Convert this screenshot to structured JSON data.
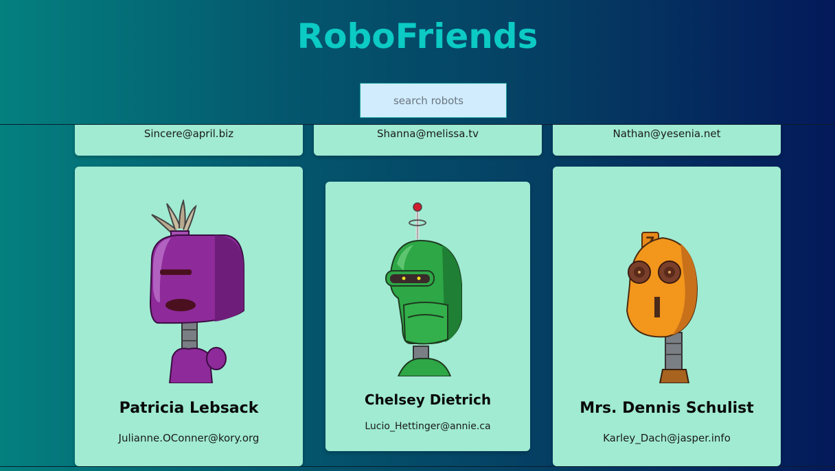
{
  "header": {
    "title": "RoboFriends"
  },
  "search": {
    "placeholder": "search robots"
  },
  "cards_partial": [
    {
      "email": "Sincere@april.biz"
    },
    {
      "email": "Shanna@melissa.tv"
    },
    {
      "email": "Nathan@yesenia.net"
    }
  ],
  "cards": [
    {
      "name": "Patricia Lebsack",
      "email": "Julianne.OConner@kory.org",
      "robot": "purple-robot"
    },
    {
      "name": "Chelsey Dietrich",
      "email": "Lucio_Hettinger@annie.ca",
      "robot": "green-robot"
    },
    {
      "name": "Mrs. Dennis Schulist",
      "email": "Karley_Dach@jasper.info",
      "robot": "orange-robot"
    }
  ]
}
